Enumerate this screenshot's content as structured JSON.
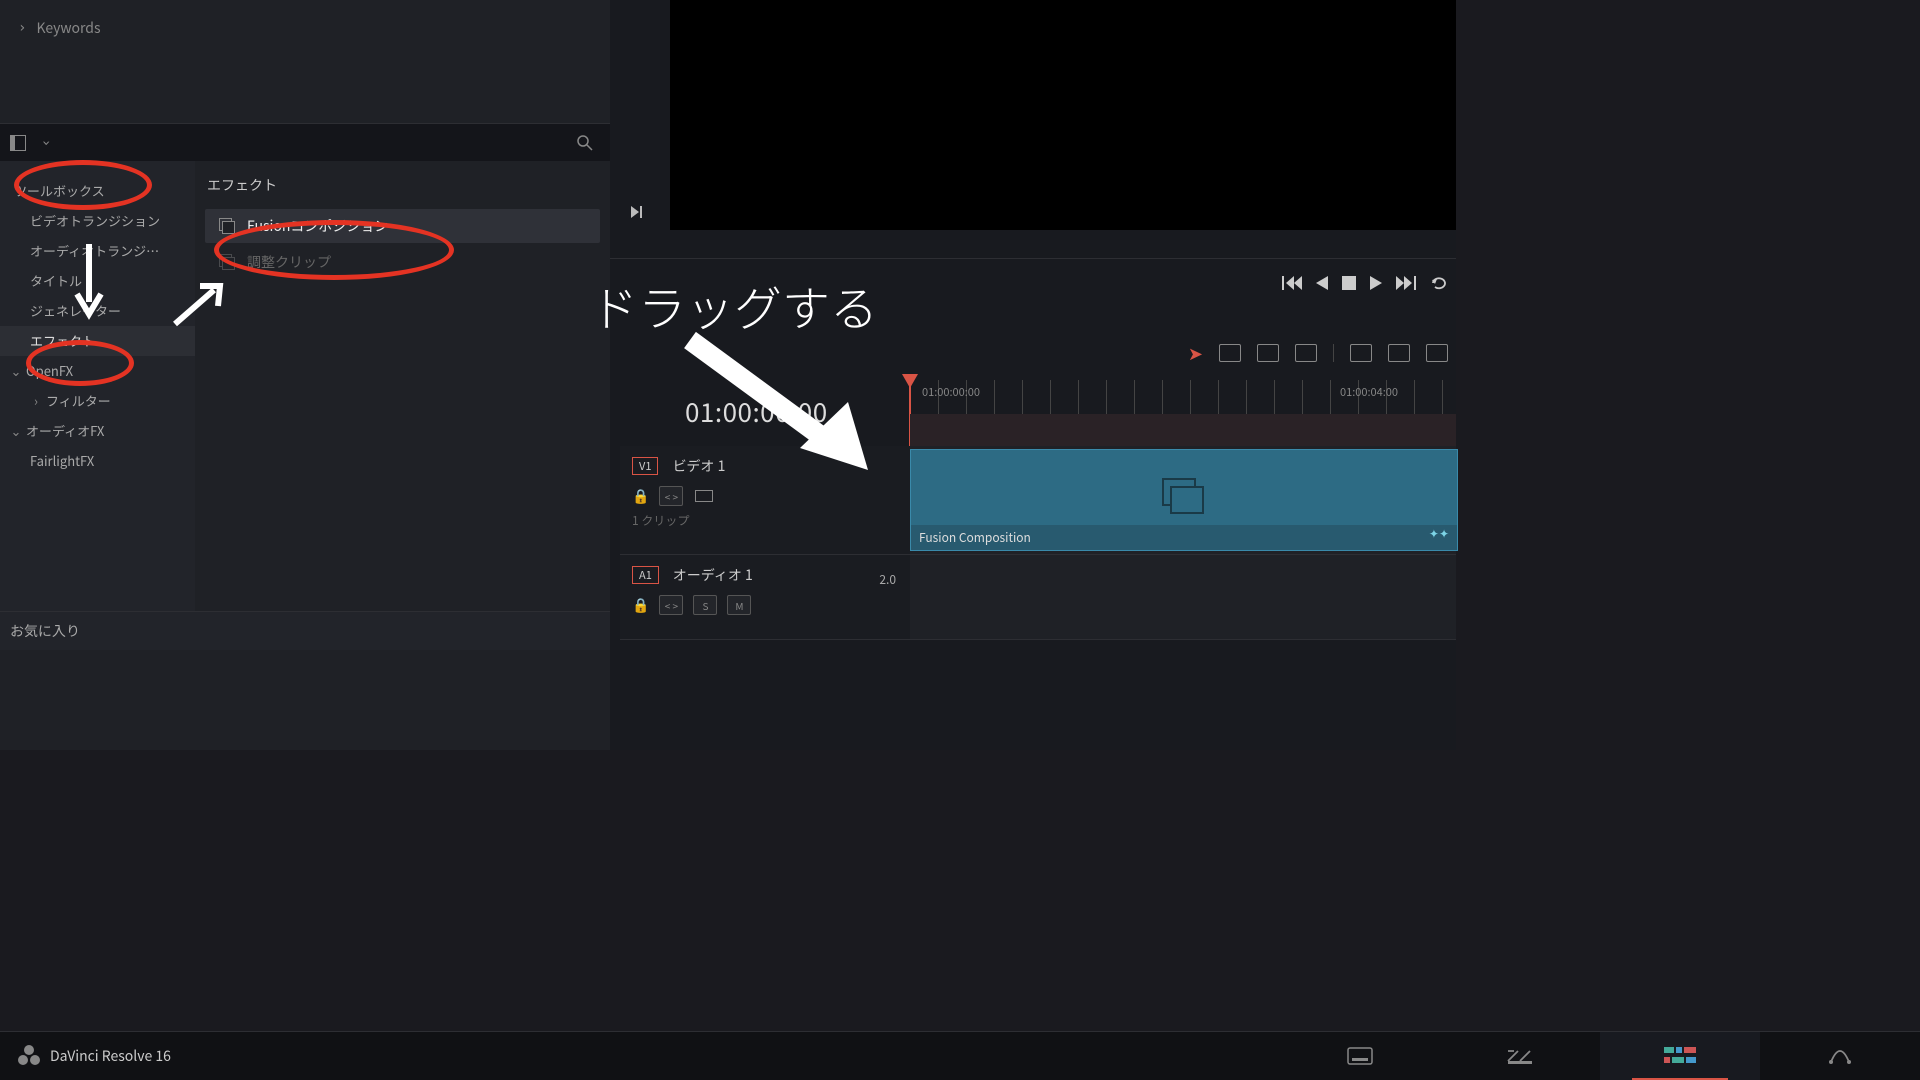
{
  "sidebar": {
    "keywords_label": "Keywords",
    "toolbox": "ツールボックス",
    "video_transition": "ビデオトランジション",
    "audio_transition": "オーディオトランジ…",
    "title": "タイトル",
    "generator": "ジェネレーター",
    "effects": "エフェクト",
    "openfx": "OpenFX",
    "filter": "フィルター",
    "audiofx": "オーディオFX",
    "fairlight": "FairlightFX",
    "favorite": "お気に入り"
  },
  "effects_panel": {
    "header": "エフェクト",
    "fusion_comp": "Fusionコンポジション",
    "adjustment": "調整クリップ"
  },
  "timeline": {
    "current_tc": "01:00:00:00",
    "tick1": "01:00:00:00",
    "tick2": "01:00:04:00",
    "v1": "V1",
    "v1_name": "ビデオ 1",
    "v1_clips": "1 クリップ",
    "a1": "A1",
    "a1_name": "オーディオ 1",
    "a1_rate": "2.0",
    "clip_name": "Fusion Composition",
    "solo": "S",
    "mute": "M",
    "code_ic": "< >"
  },
  "bottom": {
    "app": "DaVinci Resolve 16"
  },
  "annot": {
    "drag": "ドラッグする"
  }
}
